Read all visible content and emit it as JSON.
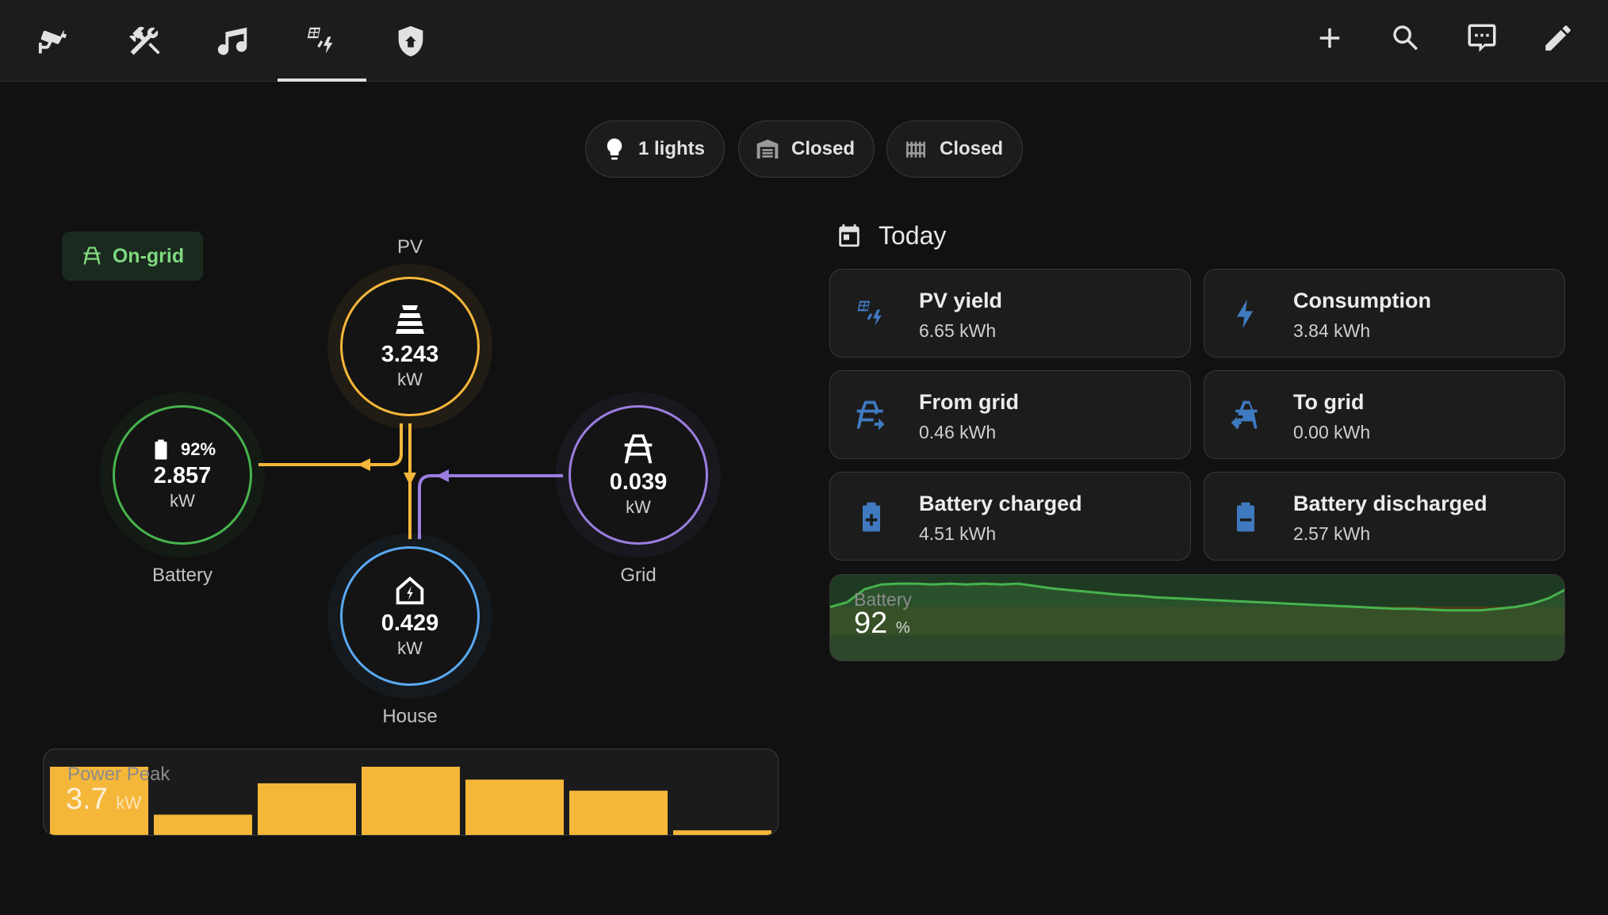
{
  "colors": {
    "pv": "#f5b73a",
    "battery": "#47b34d",
    "grid": "#9b7ee0",
    "house": "#5aa9f2",
    "tile_icon": "#3f7ac0",
    "on_grid": "#7ed97f"
  },
  "topbar": {
    "tabs": [
      {
        "icon": "cctv-icon"
      },
      {
        "icon": "tools-icon"
      },
      {
        "icon": "music-note-icon"
      },
      {
        "icon": "solar-power-icon",
        "active": true
      },
      {
        "icon": "shield-home-icon"
      }
    ],
    "actions": [
      {
        "icon": "plus-icon"
      },
      {
        "icon": "search-icon"
      },
      {
        "icon": "assist-chat-icon"
      },
      {
        "icon": "pencil-icon"
      }
    ]
  },
  "chips": [
    {
      "icon": "lightbulb-icon",
      "label": "1 lights"
    },
    {
      "icon": "garage-icon",
      "label": "Closed"
    },
    {
      "icon": "gate-icon",
      "label": "Closed"
    }
  ],
  "status": {
    "label": "On-grid"
  },
  "flow": {
    "pv": {
      "label": "PV",
      "value": "3.243",
      "unit": "kW"
    },
    "battery": {
      "label": "Battery",
      "soc": "92%",
      "value": "2.857",
      "unit": "kW"
    },
    "grid": {
      "label": "Grid",
      "value": "0.039",
      "unit": "kW"
    },
    "house": {
      "label": "House",
      "value": "0.429",
      "unit": "kW"
    }
  },
  "power_peak": {
    "title": "Power Peak",
    "value": "3.7",
    "unit": "kW",
    "bars": [
      3.7,
      1.1,
      2.8,
      3.7,
      3.0,
      2.4,
      0.25
    ],
    "max": 3.7
  },
  "today": {
    "title": "Today",
    "tiles": [
      {
        "icon": "solar-power-icon",
        "name": "PV yield",
        "value": "6.65 kWh"
      },
      {
        "icon": "lightning-icon",
        "name": "Consumption",
        "value": "3.84 kWh"
      },
      {
        "icon": "transmission-tower-import-icon",
        "name": "From grid",
        "value": "0.46 kWh"
      },
      {
        "icon": "transmission-tower-export-icon",
        "name": "To grid",
        "value": "0.00 kWh"
      },
      {
        "icon": "battery-plus-icon",
        "name": "Battery charged",
        "value": "4.51 kWh"
      },
      {
        "icon": "battery-minus-icon",
        "name": "Battery discharged",
        "value": "2.57 kWh"
      }
    ]
  },
  "battery_card": {
    "title": "Battery",
    "value": "92",
    "unit": "%",
    "history": [
      68,
      74,
      90,
      96,
      97,
      97,
      96,
      97,
      96,
      97,
      96,
      97,
      94,
      91,
      89,
      87,
      85,
      83,
      82,
      80,
      79,
      78,
      77,
      76,
      75,
      74,
      73,
      72,
      71,
      70,
      69,
      68,
      67,
      66,
      66,
      65,
      64,
      64,
      64,
      66,
      68,
      72,
      79,
      90
    ]
  }
}
